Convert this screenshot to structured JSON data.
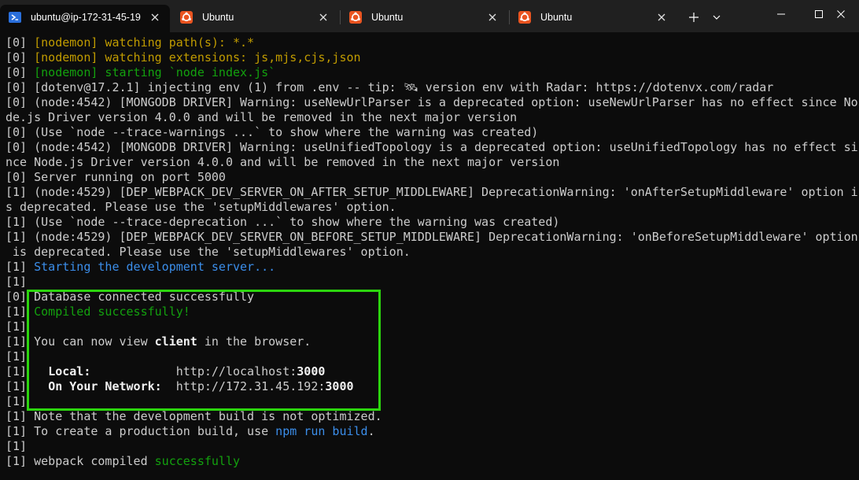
{
  "tabs": [
    {
      "title": "ubuntu@ip-172-31-45-19",
      "icon": "powershell-icon",
      "active": true
    },
    {
      "title": "Ubuntu",
      "icon": "ubuntu-icon",
      "active": false
    },
    {
      "title": "Ubuntu",
      "icon": "ubuntu-icon",
      "active": false
    },
    {
      "title": "Ubuntu",
      "icon": "ubuntu-icon",
      "active": false
    }
  ],
  "colors": {
    "background": "#0c0c0c",
    "tabbar": "#202020",
    "nodemon_yellow": "#c19c00",
    "info_blue": "#3b8eea",
    "success_green": "#13a10e",
    "highlight_box": "#2cd50e",
    "ubuntu_orange": "#e95420"
  },
  "terminal": {
    "lines": [
      [
        {
          "t": "[0] "
        },
        {
          "t": "[nodemon] watching path(s): *.*",
          "c": "yellow"
        }
      ],
      [
        {
          "t": "[0] "
        },
        {
          "t": "[nodemon] watching extensions: js,mjs,cjs,json",
          "c": "yellow"
        }
      ],
      [
        {
          "t": "[0] "
        },
        {
          "t": "[nodemon] starting `node index.js`",
          "c": "green"
        }
      ],
      [
        {
          "t": "[0] [dotenv@17.2.1] injecting env (1) from .env -- tip: 🛰 version env with Radar: https://dotenvx.com/radar"
        }
      ],
      [
        {
          "t": "[0] (node:4542) [MONGODB DRIVER] Warning: useNewUrlParser is a deprecated option: useNewUrlParser has no effect since No"
        }
      ],
      [
        {
          "t": "de.js Driver version 4.0.0 and will be removed in the next major version"
        }
      ],
      [
        {
          "t": "[0] (Use `node --trace-warnings ...` to show where the warning was created)"
        }
      ],
      [
        {
          "t": "[0] (node:4542) [MONGODB DRIVER] Warning: useUnifiedTopology is a deprecated option: useUnifiedTopology has no effect si"
        }
      ],
      [
        {
          "t": "nce Node.js Driver version 4.0.0 and will be removed in the next major version"
        }
      ],
      [
        {
          "t": "[0] Server running on port 5000"
        }
      ],
      [
        {
          "t": "[1] (node:4529) [DEP_WEBPACK_DEV_SERVER_ON_AFTER_SETUP_MIDDLEWARE] DeprecationWarning: 'onAfterSetupMiddleware' option i"
        }
      ],
      [
        {
          "t": "s deprecated. Please use the 'setupMiddlewares' option."
        }
      ],
      [
        {
          "t": "[1] (Use `node --trace-deprecation ...` to show where the warning was created)"
        }
      ],
      [
        {
          "t": "[1] (node:4529) [DEP_WEBPACK_DEV_SERVER_ON_BEFORE_SETUP_MIDDLEWARE] DeprecationWarning: 'onBeforeSetupMiddleware' option"
        }
      ],
      [
        {
          "t": " is deprecated. Please use the 'setupMiddlewares' option."
        }
      ],
      [
        {
          "t": "[1] "
        },
        {
          "t": "Starting the development server...",
          "c": "blue"
        }
      ],
      [
        {
          "t": "[1]"
        }
      ],
      [
        {
          "t": "[0] Database connected successfully"
        }
      ],
      [
        {
          "t": "[1] "
        },
        {
          "t": "Compiled successfully!",
          "c": "green"
        }
      ],
      [
        {
          "t": "[1]"
        }
      ],
      [
        {
          "t": "[1] You can now view "
        },
        {
          "t": "client",
          "c": "white-bold"
        },
        {
          "t": " in the browser."
        }
      ],
      [
        {
          "t": "[1]"
        }
      ],
      [
        {
          "t": "[1]   "
        },
        {
          "t": "Local:",
          "c": "white-bold"
        },
        {
          "t": "            http://localhost:"
        },
        {
          "t": "3000",
          "c": "white-bold"
        }
      ],
      [
        {
          "t": "[1]   "
        },
        {
          "t": "On Your Network:",
          "c": "white-bold"
        },
        {
          "t": "  http://172.31.45.192:"
        },
        {
          "t": "3000",
          "c": "white-bold"
        }
      ],
      [
        {
          "t": "[1]"
        }
      ],
      [
        {
          "t": "[1] Note that the development build is not optimized."
        }
      ],
      [
        {
          "t": "[1] To create a production build, use "
        },
        {
          "t": "npm run build",
          "c": "blue"
        },
        {
          "t": "."
        }
      ],
      [
        {
          "t": "[1]"
        }
      ],
      [
        {
          "t": "[1] webpack compiled "
        },
        {
          "t": "successfully",
          "c": "green"
        }
      ]
    ]
  }
}
